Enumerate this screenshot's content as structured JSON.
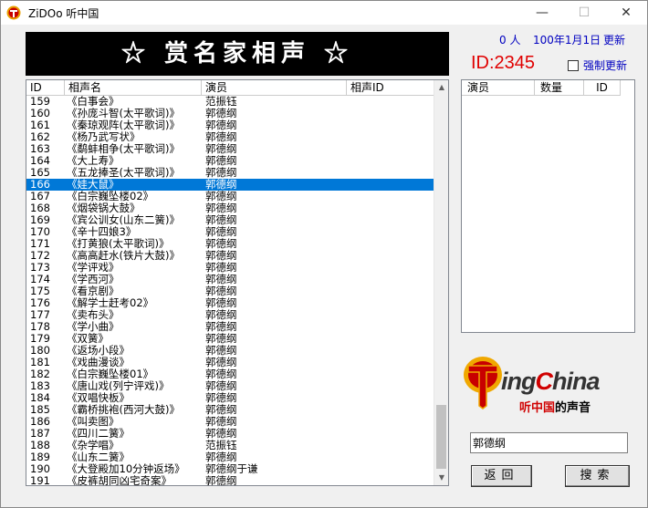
{
  "window": {
    "title": "ZiDOo  听中国",
    "controls": {
      "minimize": "—",
      "maximize": "☐",
      "close": "✕"
    }
  },
  "banner": {
    "title": "☆ 赏名家相声 ☆"
  },
  "status": {
    "count": "0 人",
    "date": "100年1月1日",
    "update": "更新",
    "id": "ID:2345",
    "force_update": "强制更新"
  },
  "list": {
    "columns": [
      "ID",
      "相声名",
      "演员",
      "相声ID"
    ],
    "selected_id": "166",
    "rows": [
      {
        "id": "159",
        "name": "《白事会》",
        "actor": "范振钰"
      },
      {
        "id": "160",
        "name": "《孙庞斗智(太平歌词)》",
        "actor": "郭德纲"
      },
      {
        "id": "161",
        "name": "《秦琼观阵(太平歌词)》",
        "actor": "郭德纲"
      },
      {
        "id": "162",
        "name": "《杨乃武写状》",
        "actor": "郭德纲"
      },
      {
        "id": "163",
        "name": "《鹬蚌相争(太平歌词)》",
        "actor": "郭德纲"
      },
      {
        "id": "164",
        "name": "《大上寿》",
        "actor": "郭德纲"
      },
      {
        "id": "165",
        "name": "《五龙捧圣(太平歌词)》",
        "actor": "郭德纲"
      },
      {
        "id": "166",
        "name": "《娃大鼠》",
        "actor": "郭德纲"
      },
      {
        "id": "167",
        "name": "《白宗巍坠楼02》",
        "actor": "郭德纲"
      },
      {
        "id": "168",
        "name": "《烟袋锅大鼓》",
        "actor": "郭德纲"
      },
      {
        "id": "169",
        "name": "《宾公训女(山东二簧)》",
        "actor": "郭德纲"
      },
      {
        "id": "170",
        "name": "《辛十四娘3》",
        "actor": "郭德纲"
      },
      {
        "id": "171",
        "name": "《打黄狼(太平歌词)》",
        "actor": "郭德纲"
      },
      {
        "id": "172",
        "name": "《高高赶水(铁片大鼓)》",
        "actor": "郭德纲"
      },
      {
        "id": "173",
        "name": "《学评戏》",
        "actor": "郭德纲"
      },
      {
        "id": "174",
        "name": "《学西河》",
        "actor": "郭德纲"
      },
      {
        "id": "175",
        "name": "《看京剧》",
        "actor": "郭德纲"
      },
      {
        "id": "176",
        "name": "《解学士赶考02》",
        "actor": "郭德纲"
      },
      {
        "id": "177",
        "name": "《卖布头》",
        "actor": "郭德纲"
      },
      {
        "id": "178",
        "name": "《学小曲》",
        "actor": "郭德纲"
      },
      {
        "id": "179",
        "name": "《双簧》",
        "actor": "郭德纲"
      },
      {
        "id": "180",
        "name": "《返场小段》",
        "actor": "郭德纲"
      },
      {
        "id": "181",
        "name": "《戏曲漫谈》",
        "actor": "郭德纲"
      },
      {
        "id": "182",
        "name": "《白宗巍坠楼01》",
        "actor": "郭德纲"
      },
      {
        "id": "183",
        "name": "《唐山戏(列宁评戏)》",
        "actor": "郭德纲"
      },
      {
        "id": "184",
        "name": "《双唱快板》",
        "actor": "郭德纲"
      },
      {
        "id": "185",
        "name": "《霸桥挑袍(西河大鼓)》",
        "actor": "郭德纲"
      },
      {
        "id": "186",
        "name": "《叫卖图》",
        "actor": "郭德纲"
      },
      {
        "id": "187",
        "name": "《四川二簧》",
        "actor": "郭德纲"
      },
      {
        "id": "188",
        "name": "《杂学唱》",
        "actor": "范振钰"
      },
      {
        "id": "189",
        "name": "《山东二簧》",
        "actor": "郭德纲"
      },
      {
        "id": "190",
        "name": "《大登殿加10分钟返场》",
        "actor": "郭德纲于谦"
      },
      {
        "id": "191",
        "name": "《皮裤胡同凶宅奇案》",
        "actor": "郭德纲"
      }
    ]
  },
  "right_list": {
    "columns": [
      "演员",
      "数量",
      "ID"
    ]
  },
  "logo": {
    "brand_pre": "T",
    "brand_main": "ing",
    "brand_hl": "C",
    "brand_end": "hina",
    "sub_red": "听中国",
    "sub_black": "的声音"
  },
  "search": {
    "value": "郭德纲"
  },
  "buttons": {
    "back": "返回",
    "search": "搜索"
  },
  "colors": {
    "selection": "#0078d7",
    "id_red": "#e00000",
    "link_blue": "#0000c0"
  }
}
